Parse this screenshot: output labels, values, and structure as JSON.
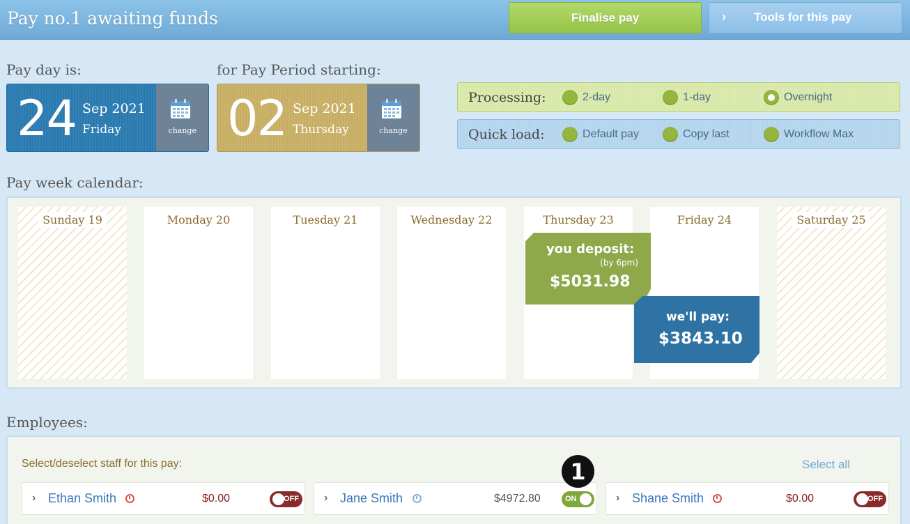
{
  "header": {
    "title": "Pay no.1 awaiting funds",
    "finalise_label": "Finalise pay",
    "tools_label": "Tools for this pay",
    "tools_chevron": "›"
  },
  "payday": {
    "label": "Pay day is:",
    "day": "24",
    "month_year": "Sep 2021",
    "weekday": "Friday",
    "change_label": "change"
  },
  "period": {
    "label": "for Pay Period starting:",
    "day": "02",
    "month_year": "Sep 2021",
    "weekday": "Thursday",
    "change_label": "change"
  },
  "processing": {
    "label": "Processing:",
    "options": [
      "2-day",
      "1-day",
      "Overnight"
    ],
    "selected": "Overnight"
  },
  "quickload": {
    "label": "Quick load:",
    "options": [
      "Default pay",
      "Copy last",
      "Workflow Max"
    ]
  },
  "calendar": {
    "label": "Pay week calendar:",
    "days": [
      "Sunday 19",
      "Monday 20",
      "Tuesday 21",
      "Wednesday 22",
      "Thursday 23",
      "Friday 24",
      "Saturday 25"
    ],
    "deposit": {
      "label": "you deposit:",
      "note": "(by 6pm)",
      "amount": "$5031.98"
    },
    "payout": {
      "label": "we'll pay:",
      "amount": "$3843.10"
    }
  },
  "employees": {
    "label": "Employees:",
    "hint": "Select/deselect staff for this pay:",
    "select_all": "Select all",
    "list": [
      {
        "name": "Ethan Smith",
        "amount": "$0.00",
        "toggle": "OFF"
      },
      {
        "name": "Jane Smith",
        "amount": "$4972.80",
        "toggle": "ON"
      },
      {
        "name": "Shane Smith",
        "amount": "$0.00",
        "toggle": "OFF"
      }
    ]
  },
  "badge": "1",
  "colors": {
    "header": "#6ea9d6",
    "finalise": "#95c447",
    "payday_box": "#2b79ad",
    "period_box": "#c6ad64",
    "deposit": "#8ea84a",
    "payout": "#2f73a4",
    "toggle_off": "#8a2a2a",
    "toggle_on": "#7fa83a"
  }
}
